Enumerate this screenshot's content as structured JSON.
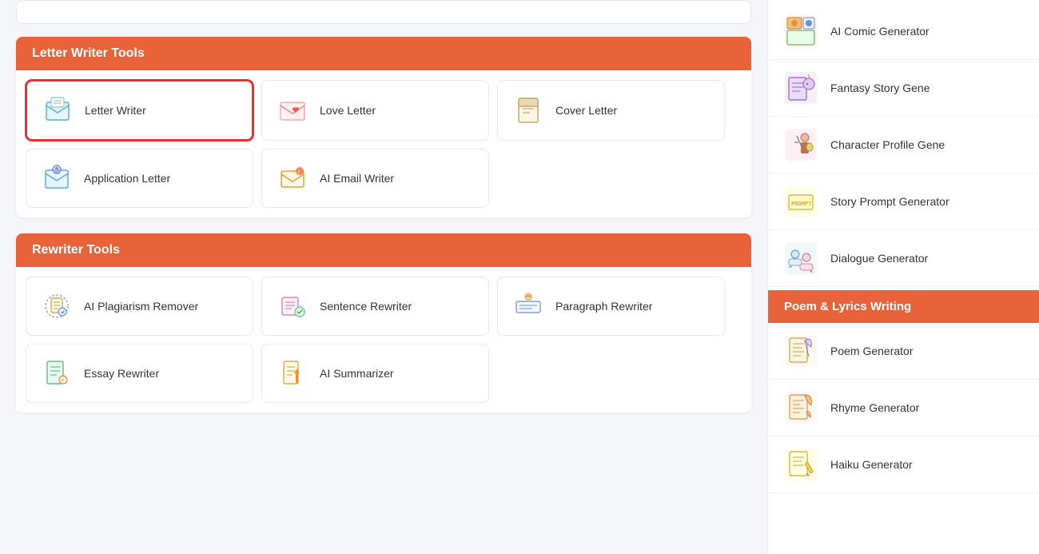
{
  "letter_section": {
    "header": "Letter Writer Tools",
    "cards": [
      {
        "id": "letter-writer",
        "label": "Letter Writer",
        "selected": true
      },
      {
        "id": "love-letter",
        "label": "Love Letter",
        "selected": false
      },
      {
        "id": "cover-letter",
        "label": "Cover Letter",
        "selected": false
      },
      {
        "id": "application-letter",
        "label": "Application Letter",
        "selected": false
      },
      {
        "id": "ai-email-writer",
        "label": "AI Email Writer",
        "selected": false
      }
    ]
  },
  "rewriter_section": {
    "header": "Rewriter Tools",
    "cards": [
      {
        "id": "ai-plagiarism-remover",
        "label": "AI Plagiarism Remover",
        "selected": false
      },
      {
        "id": "sentence-rewriter",
        "label": "Sentence Rewriter",
        "selected": false
      },
      {
        "id": "paragraph-rewriter",
        "label": "Paragraph Rewriter",
        "selected": false
      },
      {
        "id": "essay-rewriter",
        "label": "Essay Rewriter",
        "selected": false
      },
      {
        "id": "ai-summarizer",
        "label": "AI Summarizer",
        "selected": false
      }
    ]
  },
  "sidebar_story": {
    "items": [
      {
        "id": "ai-comic-generator",
        "label": "AI Comic Generator"
      },
      {
        "id": "fantasy-story-gene",
        "label": "Fantasy Story Gene"
      },
      {
        "id": "character-profile-gene",
        "label": "Character Profile Gene"
      },
      {
        "id": "story-prompt-generator",
        "label": "Story Prompt Generator"
      },
      {
        "id": "dialogue-generator",
        "label": "Dialogue Generator"
      }
    ]
  },
  "sidebar_poem": {
    "header": "Poem & Lyrics Writing",
    "items": [
      {
        "id": "poem-generator",
        "label": "Poem Generator"
      },
      {
        "id": "rhyme-generator",
        "label": "Rhyme Generator"
      },
      {
        "id": "haiku-generator",
        "label": "Haiku Generator"
      }
    ]
  }
}
